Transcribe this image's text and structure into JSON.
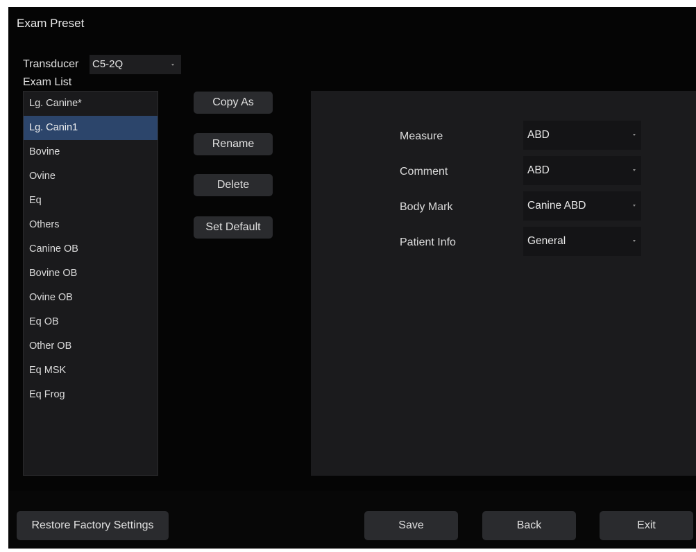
{
  "window": {
    "title": "Exam Preset"
  },
  "transducer": {
    "label": "Transducer",
    "value": "C5-2Q"
  },
  "exam_list": {
    "label": "Exam List",
    "items": [
      "Lg. Canine*",
      "Lg. Canin1",
      "Bovine",
      "Ovine",
      "Eq",
      "Others",
      "Canine OB",
      "Bovine OB",
      "Ovine OB",
      "Eq OB",
      "Other OB",
      "Eq MSK",
      "Eq Frog"
    ],
    "selected_index": 1
  },
  "actions": {
    "copy_as": "Copy As",
    "rename": "Rename",
    "delete": "Delete",
    "set_default": "Set Default"
  },
  "settings": [
    {
      "label": "Measure",
      "value": "ABD"
    },
    {
      "label": "Comment",
      "value": "ABD"
    },
    {
      "label": "Body Mark",
      "value": "Canine ABD"
    },
    {
      "label": "Patient Info",
      "value": "General"
    }
  ],
  "footer": {
    "restore": "Restore Factory Settings",
    "save": "Save",
    "back": "Back",
    "exit": "Exit"
  },
  "colors": {
    "background": "#050505",
    "selected_row": "#2c456b",
    "button": "#2a2b2e",
    "panel": "#1b1b1d"
  }
}
